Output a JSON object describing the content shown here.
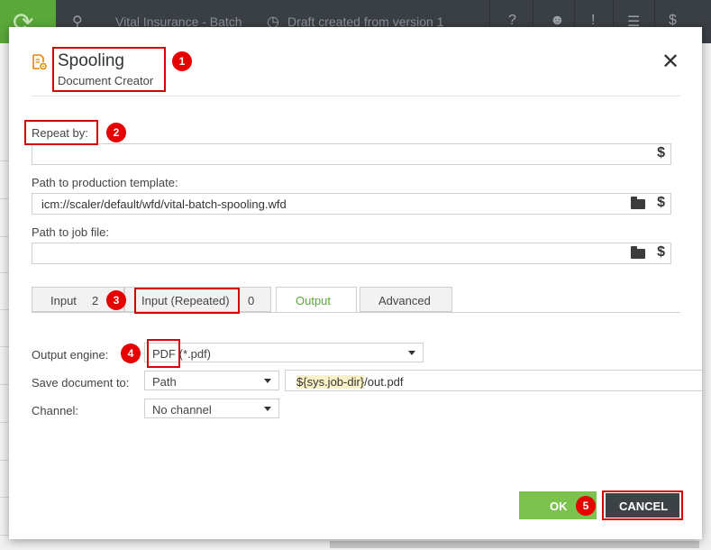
{
  "topbar": {
    "project": "Vital Insurance - Batch",
    "status": "Draft created from version 1",
    "icons": [
      "app-logo-icon",
      "person-tree-icon",
      "clock-icon",
      "help-icon",
      "user-icon",
      "alert-icon",
      "menu-icon",
      "dollar-settings-icon"
    ]
  },
  "dialog": {
    "title": "Spooling",
    "subtitle": "Document Creator",
    "repeat_by_label": "Repeat by:",
    "repeat_by_value": "",
    "template_label": "Path to production template:",
    "template_value": "icm://scaler/default/wfd/vital-batch-spooling.wfd",
    "jobfile_label": "Path to job file:",
    "jobfile_value": "",
    "dollar_symbol": "$",
    "tabs": [
      {
        "label": "Input",
        "count": "2"
      },
      {
        "label": "Input (Repeated)",
        "count": "0"
      },
      {
        "label": "Output",
        "count": ""
      },
      {
        "label": "Advanced",
        "count": ""
      }
    ],
    "active_tab": "Output",
    "output_engine_label": "Output engine:",
    "output_engine_prefix": "PDF",
    "output_engine_suffix": " (*.pdf)",
    "save_to_label": "Save document to:",
    "save_to_value": "Path",
    "path_variable": "${sys.job-dir}",
    "path_rest": "/out.pdf",
    "channel_label": "Channel:",
    "channel_value": "No channel",
    "ok_label": "OK",
    "cancel_label": "CANCEL"
  },
  "annotations": [
    "1",
    "2",
    "3",
    "4",
    "5"
  ],
  "colors": {
    "accent": "#5aa83a",
    "ok_button": "#7cc24e",
    "cancel_button": "#3d4246",
    "annotation": "#e60000",
    "topbar": "#3a3f44"
  }
}
